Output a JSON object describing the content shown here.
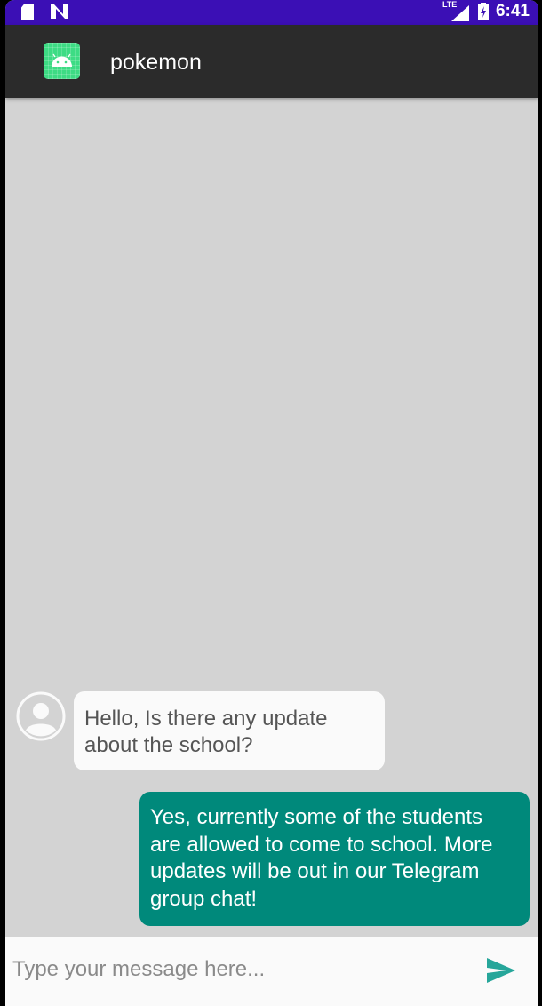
{
  "status_bar": {
    "time": "6:41",
    "network": "LTE"
  },
  "app_bar": {
    "title": "pokemon",
    "icon": "android-icon"
  },
  "messages": [
    {
      "direction": "received",
      "text": "Hello, Is there any update about the school?",
      "avatar_icon": "person-icon"
    },
    {
      "direction": "sent",
      "text": "Yes, currently some of the students are allowed to come to school. More updates will be out in our Telegram group chat!"
    }
  ],
  "composer": {
    "placeholder": "Type your message here...",
    "value": "",
    "send_icon": "send-icon"
  },
  "colors": {
    "status_bar": "#3b0fb5",
    "app_bar": "#2b2b2b",
    "chat_background": "#d3d3d3",
    "sent_bubble": "#00897b",
    "received_bubble": "#fafafa",
    "logo": "#3ddc84",
    "accent": "#26a69a"
  }
}
